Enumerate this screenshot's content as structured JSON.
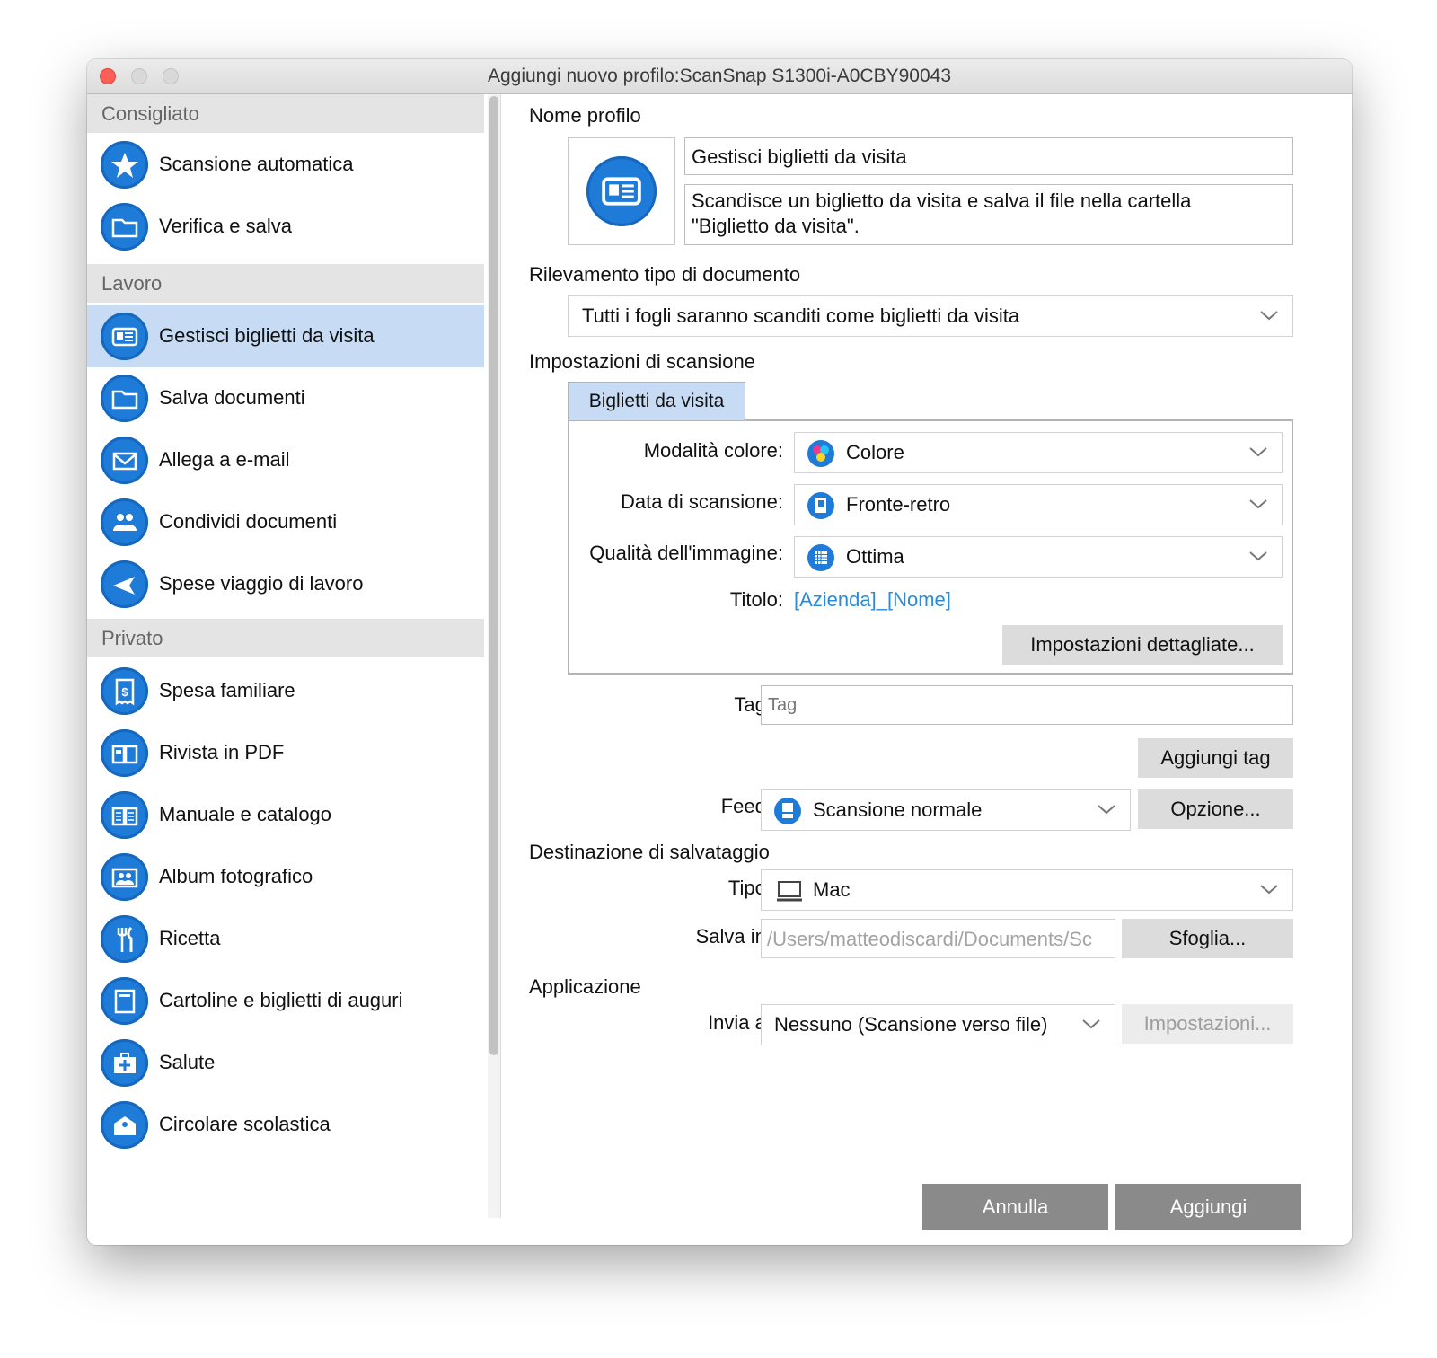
{
  "window": {
    "title": "Aggiungi nuovo profilo:ScanSnap S1300i-A0CBY90043"
  },
  "sidebar": {
    "sections": [
      {
        "label": "Consigliato"
      },
      {
        "label": "Lavoro"
      },
      {
        "label": "Privato"
      }
    ],
    "items": [
      {
        "label": "Scansione automatica",
        "icon": "star-icon"
      },
      {
        "label": "Verifica e salva",
        "icon": "folder-icon"
      },
      {
        "label": "Gestisci biglietti da visita",
        "icon": "business-card-icon",
        "selected": true
      },
      {
        "label": "Salva documenti",
        "icon": "folder-icon"
      },
      {
        "label": "Allega a e-mail",
        "icon": "envelope-icon"
      },
      {
        "label": "Condividi documenti",
        "icon": "people-icon"
      },
      {
        "label": "Spese viaggio di lavoro",
        "icon": "airplane-icon"
      },
      {
        "label": "Spesa familiare",
        "icon": "receipt-icon"
      },
      {
        "label": "Rivista in PDF",
        "icon": "magazine-icon"
      },
      {
        "label": "Manuale e catalogo",
        "icon": "book-icon"
      },
      {
        "label": "Album fotografico",
        "icon": "photo-album-icon"
      },
      {
        "label": "Ricetta",
        "icon": "fork-knife-icon"
      },
      {
        "label": "Cartoline e biglietti di auguri",
        "icon": "postcard-icon"
      },
      {
        "label": "Salute",
        "icon": "medical-kit-icon"
      },
      {
        "label": "Circolare scolastica",
        "icon": "school-icon"
      }
    ]
  },
  "profile": {
    "section_label": "Nome profilo",
    "name": "Gestisci biglietti da visita",
    "description_line1": "Scandisce un biglietto da visita e salva il file nella cartella",
    "description_line2": "\"Biglietto da visita\"."
  },
  "detection": {
    "section_label": "Rilevamento tipo di documento",
    "value": "Tutti i fogli saranno scanditi come biglietti da visita"
  },
  "scan_settings": {
    "section_label": "Impostazioni di scansione",
    "tab": "Biglietti da visita",
    "color_mode_label": "Modalità colore:",
    "color_mode_value": "Colore",
    "scan_side_label": "Data di scansione:",
    "scan_side_value": "Fronte-retro",
    "quality_label": "Qualità dell'immagine:",
    "quality_value": "Ottima",
    "title_label": "Titolo:",
    "title_value": "[Azienda]_[Nome]",
    "detailed_button": "Impostazioni dettagliate..."
  },
  "tag": {
    "label": "Tag:",
    "placeholder": "Tag",
    "add_button": "Aggiungi tag"
  },
  "feed": {
    "label": "Feed:",
    "value": "Scansione normale",
    "option_button": "Opzione..."
  },
  "destination": {
    "section_label": "Destinazione di salvataggio",
    "type_label": "Tipo:",
    "type_value": "Mac",
    "save_in_label": "Salva in:",
    "save_in_value": "/Users/matteodiscardi/Documents/Sc",
    "browse_button": "Sfoglia..."
  },
  "application": {
    "section_label": "Applicazione",
    "send_to_label": "Invia a:",
    "send_to_value": "Nessuno (Scansione verso file)",
    "settings_button": "Impostazioni..."
  },
  "footer": {
    "cancel_button": "Annulla",
    "add_button": "Aggiungi"
  },
  "colors": {
    "accent": "#1f7bd8",
    "selected_row": "#c7dcf4",
    "link": "#2a8bd8",
    "close_button": "#fc5f57"
  }
}
